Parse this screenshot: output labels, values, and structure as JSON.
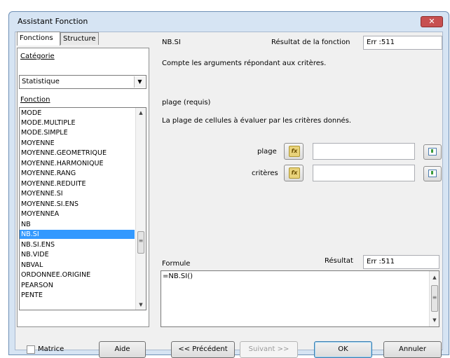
{
  "window": {
    "title": "Assistant Fonction",
    "close_symbol": "✕"
  },
  "tabs": [
    {
      "label": "Fonctions"
    },
    {
      "label": "Structure"
    }
  ],
  "category": {
    "label": "Catégorie",
    "value": "Statistique"
  },
  "function_label": "Fonction",
  "functions": [
    "MODE",
    "MODE.MULTIPLE",
    "MODE.SIMPLE",
    "MOYENNE",
    "MOYENNE.GEOMETRIQUE",
    "MOYENNE.HARMONIQUE",
    "MOYENNE.RANG",
    "MOYENNE.REDUITE",
    "MOYENNE.SI",
    "MOYENNE.SI.ENS",
    "MOYENNEA",
    "NB",
    "NB.SI",
    "NB.SI.ENS",
    "NB.VIDE",
    "NBVAL",
    "ORDONNEE.ORIGINE",
    "PEARSON",
    "PENTE"
  ],
  "selected_function": "NB.SI",
  "function_name": "NB.SI",
  "function_result": {
    "label": "Résultat de la fonction",
    "value": "Err :511"
  },
  "description": "Compte les arguments répondant aux critères.",
  "argument_info": {
    "title": "plage (requis)",
    "description": "La plage de cellules à évaluer par les critères donnés."
  },
  "arguments": [
    {
      "label": "plage",
      "value": ""
    },
    {
      "label": "critères",
      "value": ""
    }
  ],
  "formula": {
    "label": "Formule",
    "value": "=NB.SI()"
  },
  "result": {
    "label": "Résultat",
    "value": "Err :511"
  },
  "buttons": {
    "matrix": "Matrice",
    "help": "Aide",
    "previous": "<< Précédent",
    "next": "Suivant >>",
    "ok": "OK",
    "cancel": "Annuler"
  },
  "icons": {
    "fx": "fx",
    "scroll_up": "▲",
    "scroll_down": "▼",
    "dropdown": "▼",
    "grip": "≡"
  }
}
